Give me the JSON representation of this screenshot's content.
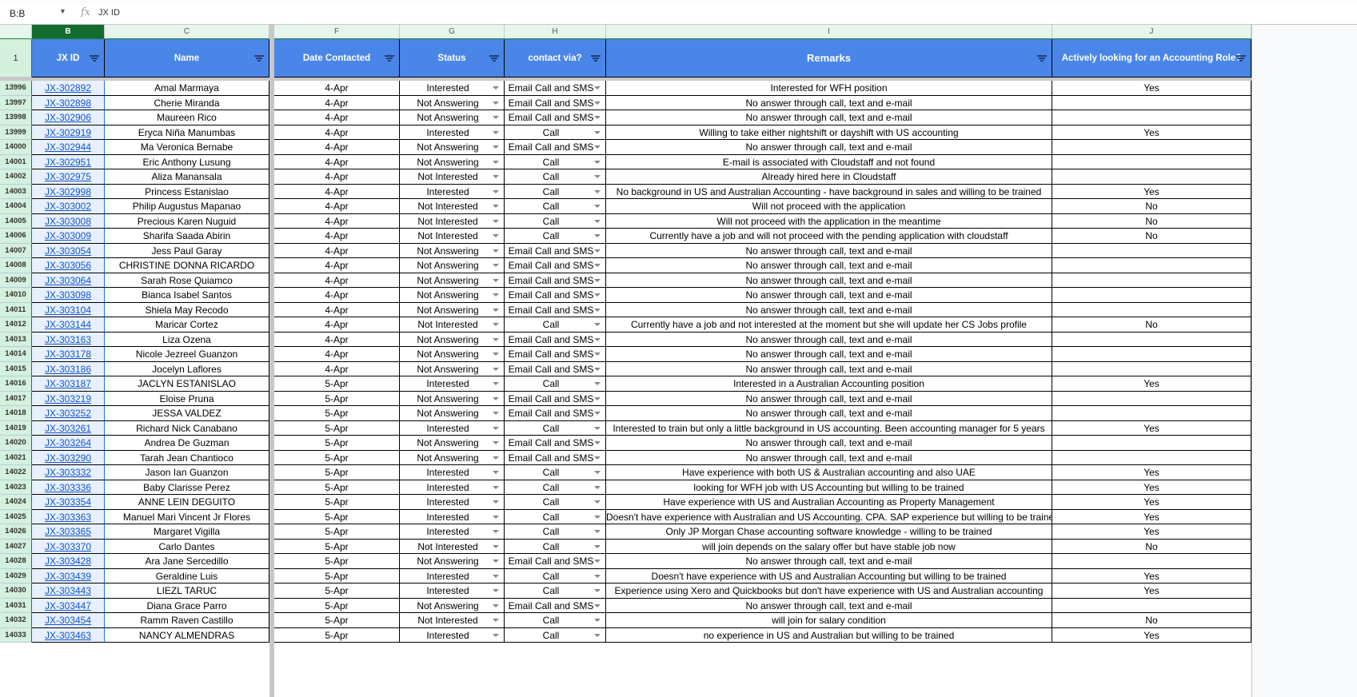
{
  "formula_bar": {
    "name_box": "B:B",
    "fx": "fx",
    "value": "JX ID"
  },
  "col_letters": [
    "B",
    "C",
    "F",
    "G",
    "H",
    "I",
    "J"
  ],
  "header_row_number": "1",
  "headers": [
    "JX ID",
    "Name",
    "Date Contacted",
    "Status",
    "contact via?",
    "Remarks",
    "Actively looking for an Accounting Role?"
  ],
  "rows": [
    [
      "13996",
      "JX-302892",
      "Amal Marmaya",
      "4-Apr",
      "Interested",
      "Email Call and SMS",
      "Interested for WFH position",
      "Yes"
    ],
    [
      "13997",
      "JX-302898",
      "Cherie Miranda",
      "4-Apr",
      "Not Answering",
      "Email Call and SMS",
      "No answer through call, text and e-mail",
      ""
    ],
    [
      "13998",
      "JX-302906",
      "Maureen Rico",
      "4-Apr",
      "Not Answering",
      "Email Call and SMS",
      "No answer through call, text and e-mail",
      ""
    ],
    [
      "13999",
      "JX-302919",
      "Eryca Niña Manumbas",
      "4-Apr",
      "Interested",
      "Call",
      "Willing to take either nightshift or dayshift with US accounting",
      "Yes"
    ],
    [
      "14000",
      "JX-302944",
      "Ma Veronica Bernabe",
      "4-Apr",
      "Not Answering",
      "Email Call and SMS",
      "No answer through call, text and e-mail",
      ""
    ],
    [
      "14001",
      "JX-302951",
      "Eric Anthony Lusung",
      "4-Apr",
      "Not Answering",
      "Call",
      "E-mail is associated with Cloudstaff and not found",
      ""
    ],
    [
      "14002",
      "JX-302975",
      "Aliza Manansala",
      "4-Apr",
      "Not Interested",
      "Call",
      "Already hired here in Cloudstaff",
      ""
    ],
    [
      "14003",
      "JX-302998",
      "Princess Estanislao",
      "4-Apr",
      "Interested",
      "Call",
      "No background in US and Australian Accounting - have background in sales and willing to be trained",
      "Yes"
    ],
    [
      "14004",
      "JX-303002",
      "Philip Augustus Mapanao",
      "4-Apr",
      "Not Interested",
      "Call",
      "Will not proceed with the application",
      "No"
    ],
    [
      "14005",
      "JX-303008",
      "Precious Karen Nuguid",
      "4-Apr",
      "Not Interested",
      "Call",
      "Will not proceed with the application in the meantime",
      "No"
    ],
    [
      "14006",
      "JX-303009",
      "Sharifa Saada Abirin",
      "4-Apr",
      "Not Interested",
      "Call",
      "Currently have a job and will not proceed with the pending application with cloudstaff",
      "No"
    ],
    [
      "14007",
      "JX-303054",
      "Jess Paul Garay",
      "4-Apr",
      "Not Answering",
      "Email Call and SMS",
      "No answer through call, text and e-mail",
      ""
    ],
    [
      "14008",
      "JX-303056",
      "CHRISTINE DONNA RICARDO",
      "4-Apr",
      "Not Answering",
      "Email Call and SMS",
      "No answer through call, text and e-mail",
      ""
    ],
    [
      "14009",
      "JX-303064",
      "Sarah Rose Quiamco",
      "4-Apr",
      "Not Answering",
      "Email Call and SMS",
      "No answer through call, text and e-mail",
      ""
    ],
    [
      "14010",
      "JX-303098",
      "Bianca Isabel Santos",
      "4-Apr",
      "Not Answering",
      "Email Call and SMS",
      "No answer through call, text and e-mail",
      ""
    ],
    [
      "14011",
      "JX-303104",
      "Shiela May Recodo",
      "4-Apr",
      "Not Answering",
      "Email Call and SMS",
      "No answer through call, text and e-mail",
      ""
    ],
    [
      "14012",
      "JX-303144",
      "Maricar Cortez",
      "4-Apr",
      "Not Interested",
      "Call",
      "Currently have a job and not interested at the moment but she will update her CS Jobs profile",
      "No"
    ],
    [
      "14013",
      "JX-303163",
      "Liza Ozena",
      "4-Apr",
      "Not Answering",
      "Email Call and SMS",
      "No answer through call, text and e-mail",
      ""
    ],
    [
      "14014",
      "JX-303178",
      "Nicole Jezreel Guanzon",
      "4-Apr",
      "Not Answering",
      "Email Call and SMS",
      "No answer through call, text and e-mail",
      ""
    ],
    [
      "14015",
      "JX-303186",
      "Jocelyn Laflores",
      "4-Apr",
      "Not Answering",
      "Email Call and SMS",
      "No answer through call, text and e-mail",
      ""
    ],
    [
      "14016",
      "JX-303187",
      "JACLYN ESTANISLAO",
      "5-Apr",
      "Interested",
      "Call",
      "Interested in a Australian Accounting position",
      "Yes"
    ],
    [
      "14017",
      "JX-303219",
      "Eloise Pruna",
      "5-Apr",
      "Not Answering",
      "Email Call and SMS",
      "No answer through call, text and e-mail",
      ""
    ],
    [
      "14018",
      "JX-303252",
      "JESSA VALDEZ",
      "5-Apr",
      "Not Answering",
      "Email Call and SMS",
      "No answer through call, text and e-mail",
      ""
    ],
    [
      "14019",
      "JX-303261",
      "Richard Nick Canabano",
      "5-Apr",
      "Interested",
      "Call",
      "Interested to train but only a little background in US accounting. Been accounting manager for 5 years",
      "Yes"
    ],
    [
      "14020",
      "JX-303264",
      "Andrea De Guzman",
      "5-Apr",
      "Not Answering",
      "Email Call and SMS",
      "No answer through call, text and e-mail",
      ""
    ],
    [
      "14021",
      "JX-303290",
      "Tarah Jean Chantioco",
      "5-Apr",
      "Not Answering",
      "Email Call and SMS",
      "No answer through call, text and e-mail",
      ""
    ],
    [
      "14022",
      "JX-303332",
      "Jason Ian Guanzon",
      "5-Apr",
      "Interested",
      "Call",
      "Have experience with both US & Australian accounting and also UAE",
      "Yes"
    ],
    [
      "14023",
      "JX-303336",
      "Baby Clarisse Perez",
      "5-Apr",
      "Interested",
      "Call",
      "looking for WFH job with US Accounting but willing to be trained",
      "Yes"
    ],
    [
      "14024",
      "JX-303354",
      "ANNE LEIN DEGUITO",
      "5-Apr",
      "Interested",
      "Call",
      "Have experience with US and Australian Accounting as Property Management",
      "Yes"
    ],
    [
      "14025",
      "JX-303363",
      "Manuel Mari Vincent Jr Flores",
      "5-Apr",
      "Interested",
      "Call",
      "Doesn't have experience with Australian and US Accounting. CPA. SAP experience but willing to be trained",
      "Yes"
    ],
    [
      "14026",
      "JX-303365",
      "Margaret Vigilla",
      "5-Apr",
      "Interested",
      "Call",
      "Only JP Morgan Chase accounting software knowledge - willing to be trained",
      "Yes"
    ],
    [
      "14027",
      "JX-303370",
      "Carlo Dantes",
      "5-Apr",
      "Not Interested",
      "Call",
      "will join depends on the salary offer but have stable job now",
      "No"
    ],
    [
      "14028",
      "JX-303428",
      "Ara Jane Sercedillo",
      "5-Apr",
      "Not Answering",
      "Email Call and SMS",
      "No answer through call, text and e-mail",
      ""
    ],
    [
      "14029",
      "JX-303439",
      "Geraldine Luis",
      "5-Apr",
      "Interested",
      "Call",
      "Doesn't have experience with US and Australian Accounting but willing to be trained",
      "Yes"
    ],
    [
      "14030",
      "JX-303443",
      "LIEZL TARUC",
      "5-Apr",
      "Interested",
      "Call",
      "Experience using Xero and Quickbooks but don't have experience with US and Australian accounting",
      "Yes"
    ],
    [
      "14031",
      "JX-303447",
      "Diana Grace Parro",
      "5-Apr",
      "Not Answering",
      "Email Call and SMS",
      "No answer through call, text and e-mail",
      ""
    ],
    [
      "14032",
      "JX-303454",
      "Ramm Raven Castillo",
      "5-Apr",
      "Not Interested",
      "Call",
      "will join for salary condition",
      "No"
    ],
    [
      "14033",
      "JX-303463",
      "NANCY ALMENDRAS",
      "5-Apr",
      "Interested",
      "Call",
      "no experience in US and Australian but willing to be trained",
      "Yes"
    ]
  ]
}
